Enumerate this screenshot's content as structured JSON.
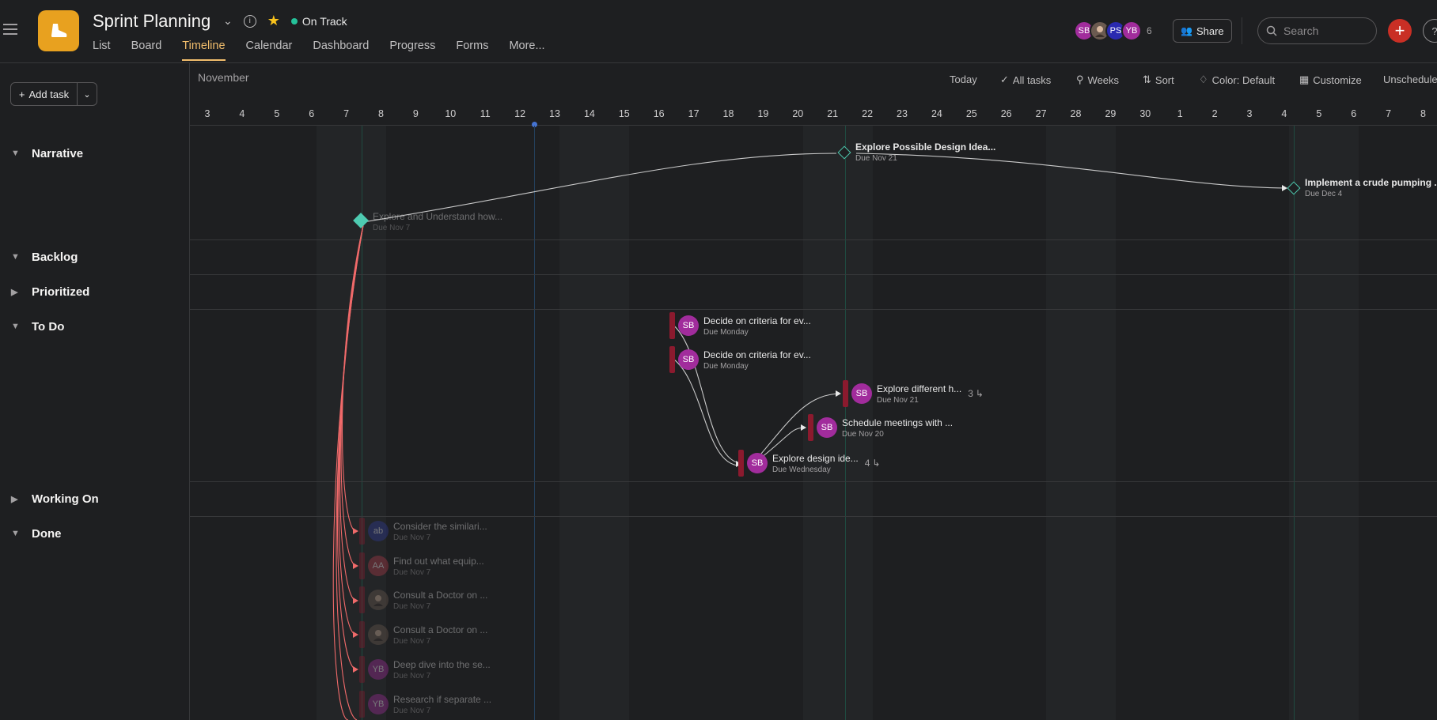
{
  "project": {
    "title": "Sprint Planning",
    "status": "On Track",
    "status_color": "#25c29a",
    "icon": "shoe-icon"
  },
  "tabs": [
    "List",
    "Board",
    "Timeline",
    "Calendar",
    "Dashboard",
    "Progress",
    "Forms",
    "More..."
  ],
  "active_tab": "Timeline",
  "members": {
    "avatars": [
      {
        "initials": "SB",
        "color": "#a12c9c"
      },
      {
        "initials": "",
        "color": "#6b5a50"
      },
      {
        "initials": "PS",
        "color": "#2a2ab0"
      },
      {
        "initials": "YB",
        "color": "#a12c9c"
      }
    ],
    "count": "6"
  },
  "header": {
    "share_label": "Share",
    "search_placeholder": "Search"
  },
  "left": {
    "add_task_label": "Add task",
    "sections": [
      {
        "name": "Narrative",
        "expanded": true
      },
      {
        "name": "Backlog",
        "expanded": true
      },
      {
        "name": "Prioritized",
        "expanded": false
      },
      {
        "name": "To Do",
        "expanded": true
      },
      {
        "name": "Working On",
        "expanded": false
      },
      {
        "name": "Done",
        "expanded": true
      }
    ]
  },
  "toolbar": {
    "month": "November",
    "today": "Today",
    "all_tasks": "All tasks",
    "weeks": "Weeks",
    "sort": "Sort",
    "color": "Color: Default",
    "customize": "Customize",
    "unscheduled": "Unschedule"
  },
  "days": [
    "3",
    "4",
    "5",
    "6",
    "7",
    "8",
    "9",
    "10",
    "11",
    "12",
    "13",
    "14",
    "15",
    "16",
    "17",
    "18",
    "19",
    "20",
    "21",
    "22",
    "23",
    "24",
    "25",
    "26",
    "27",
    "28",
    "29",
    "30",
    "1",
    "2",
    "3",
    "4",
    "5",
    "6",
    "7",
    "8"
  ],
  "milestones": [
    {
      "name": "Explore and Understand how...",
      "due": "Due Nov 7",
      "completed": true
    },
    {
      "name": "Explore Possible Design Idea...",
      "due": "Due Nov 21",
      "completed": false
    },
    {
      "name": "Implement a crude pumping ...",
      "due": "Due Dec 4",
      "completed": false
    }
  ],
  "todo_tasks": [
    {
      "name": "Decide on criteria for ev...",
      "due": "Due Monday",
      "assignee": "SB",
      "subtasks": ""
    },
    {
      "name": "Decide on criteria for ev...",
      "due": "Due Monday",
      "assignee": "SB",
      "subtasks": ""
    },
    {
      "name": "Explore different h...",
      "due": "Due Nov 21",
      "assignee": "SB",
      "subtasks": "3"
    },
    {
      "name": "Schedule meetings with ...",
      "due": "Due Nov 20",
      "assignee": "SB",
      "subtasks": ""
    },
    {
      "name": "Explore design ide...",
      "due": "Due Wednesday",
      "assignee": "SB",
      "subtasks": "4"
    }
  ],
  "done_tasks": [
    {
      "name": "Consider the similari...",
      "due": "Due Nov 7",
      "assignee": "ab",
      "color": "#2f3a9a"
    },
    {
      "name": "Find out what equip...",
      "due": "Due Nov 7",
      "assignee": "AA",
      "color": "#b23a4a"
    },
    {
      "name": "Consult a Doctor on ...",
      "due": "Due Nov 7",
      "assignee": "",
      "color": "#6b5a50"
    },
    {
      "name": "Consult a Doctor on ...",
      "due": "Due Nov 7",
      "assignee": "",
      "color": "#6b5a50"
    },
    {
      "name": "Deep dive into the se...",
      "due": "Due Nov 7",
      "assignee": "YB",
      "color": "#a12c9c"
    },
    {
      "name": "Research if separate ...",
      "due": "Due Nov 7",
      "assignee": "YB",
      "color": "#a12c9c"
    }
  ],
  "colors": {
    "accent": "#f1bd6c",
    "task_bar": "#8b1a2e",
    "milestone": "#4ecbb1",
    "dependency_line": "#e8e8e8",
    "done_dependency_line": "#f06a6a",
    "today_marker": "#4573d2"
  }
}
